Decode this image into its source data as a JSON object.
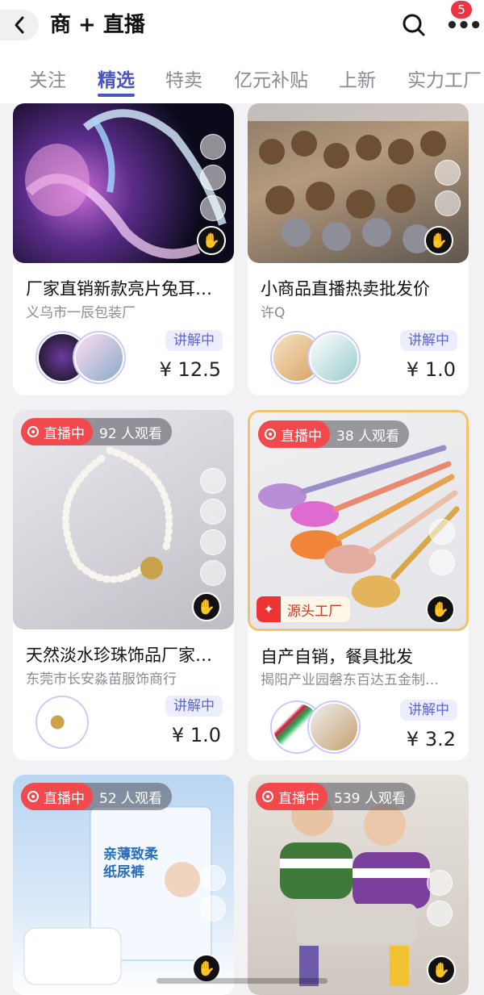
{
  "header": {
    "title": "商 + 直播",
    "notification_count": "5"
  },
  "tabs": [
    {
      "label": "关注"
    },
    {
      "label": "精选"
    },
    {
      "label": "特卖"
    },
    {
      "label": "亿元补贴"
    },
    {
      "label": "上新"
    },
    {
      "label": "实力工厂"
    }
  ],
  "cards": [
    {
      "title": "厂家直销新款亮片兔耳…",
      "seller": "义乌市一辰包装厂",
      "tag": "讲解中",
      "price": "¥ 12.5"
    },
    {
      "title": "小商品直播热卖批发价",
      "seller": "许Q",
      "tag": "讲解中",
      "price": "¥ 1.0"
    },
    {
      "title": "天然淡水珍珠饰品厂家…",
      "seller": "东莞市长安淼苗服饰商行",
      "tag": "讲解中",
      "price": "¥ 1.0",
      "live": "直播中",
      "viewers": "92 人观看"
    },
    {
      "title": "自产自销，餐具批发",
      "seller": "揭阳产业园磐东百达五金制…",
      "tag": "讲解中",
      "price": "¥ 3.2",
      "live": "直播中",
      "viewers": "38 人观看",
      "source": "源头工厂"
    },
    {
      "live": "直播中",
      "viewers": "52 人观看",
      "packaging_text": "亲薄致柔 纸尿裤"
    },
    {
      "live": "直播中",
      "viewers": "539 人观看"
    }
  ],
  "colors": {
    "accent": "#4b54c6",
    "live_red": "#f2494d",
    "badge_red": "#ee3344"
  }
}
